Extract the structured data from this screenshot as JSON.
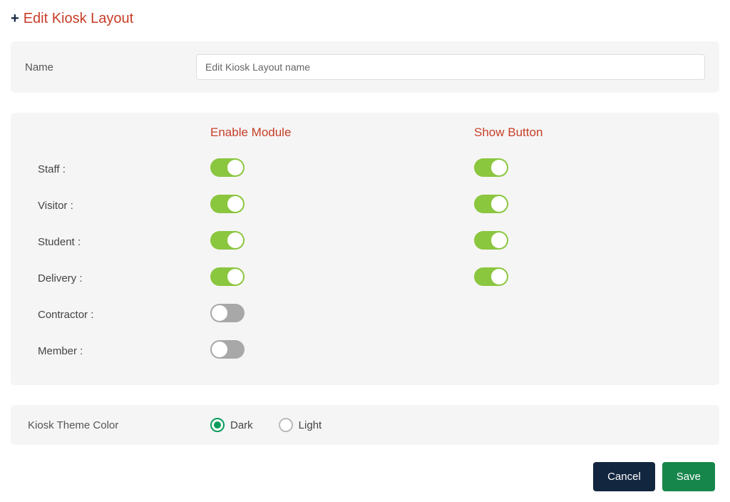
{
  "header": {
    "icon": "+",
    "title": "Edit Kiosk Layout"
  },
  "name_section": {
    "label": "Name",
    "value": "Edit Kiosk Layout name"
  },
  "modules": {
    "col1_title": "Enable Module",
    "col2_title": "Show Button",
    "rows": [
      {
        "label": "Staff :",
        "enable": true,
        "show": true,
        "show_visible": true
      },
      {
        "label": "Visitor :",
        "enable": true,
        "show": true,
        "show_visible": true
      },
      {
        "label": "Student :",
        "enable": true,
        "show": true,
        "show_visible": true
      },
      {
        "label": "Delivery :",
        "enable": true,
        "show": true,
        "show_visible": true
      },
      {
        "label": "Contractor :",
        "enable": false,
        "show": false,
        "show_visible": false
      },
      {
        "label": "Member :",
        "enable": false,
        "show": false,
        "show_visible": false
      }
    ]
  },
  "theme": {
    "label": "Kiosk Theme Color",
    "options": [
      {
        "label": "Dark",
        "selected": true
      },
      {
        "label": "Light",
        "selected": false
      }
    ]
  },
  "actions": {
    "cancel": "Cancel",
    "save": "Save"
  }
}
